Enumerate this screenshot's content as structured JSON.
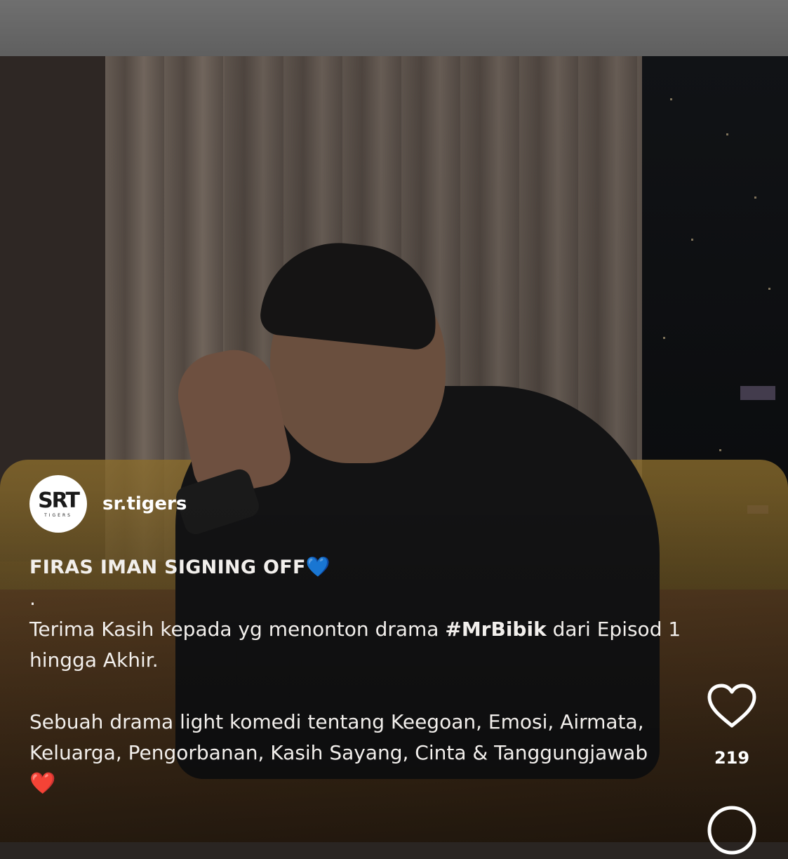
{
  "account": {
    "avatar_logo": "SRT",
    "avatar_sub": "TIGERS",
    "username": "sr.tigers"
  },
  "watermark": {
    "main": "SRT",
    "sub": "TIGERS"
  },
  "caption": {
    "title": "FIRAS IMAN SIGNING OFF",
    "title_emoji": "💙",
    "dot": ".",
    "line1_before": "Terima Kasih kepada yg menonton drama ",
    "hashtag": "#MrBibik",
    "line1_after": " dari Episod 1 hingga Akhir.",
    "line2": "Sebuah drama light komedi tentang Keegoan, Emosi, Airmata, Keluarga, Pengorbanan, Kasih Sayang, Cinta & Tanggungjawab",
    "end_emoji": "❤️"
  },
  "actions": {
    "like_icon": "heart-outline-icon",
    "like_count": "219",
    "comment_icon": "comment-bubble-icon"
  },
  "colors": {
    "top_bar": "#6a6a6a",
    "text": "#ffffff",
    "hashtag_heart": "#2f7df6",
    "red_heart": "#e53935"
  }
}
